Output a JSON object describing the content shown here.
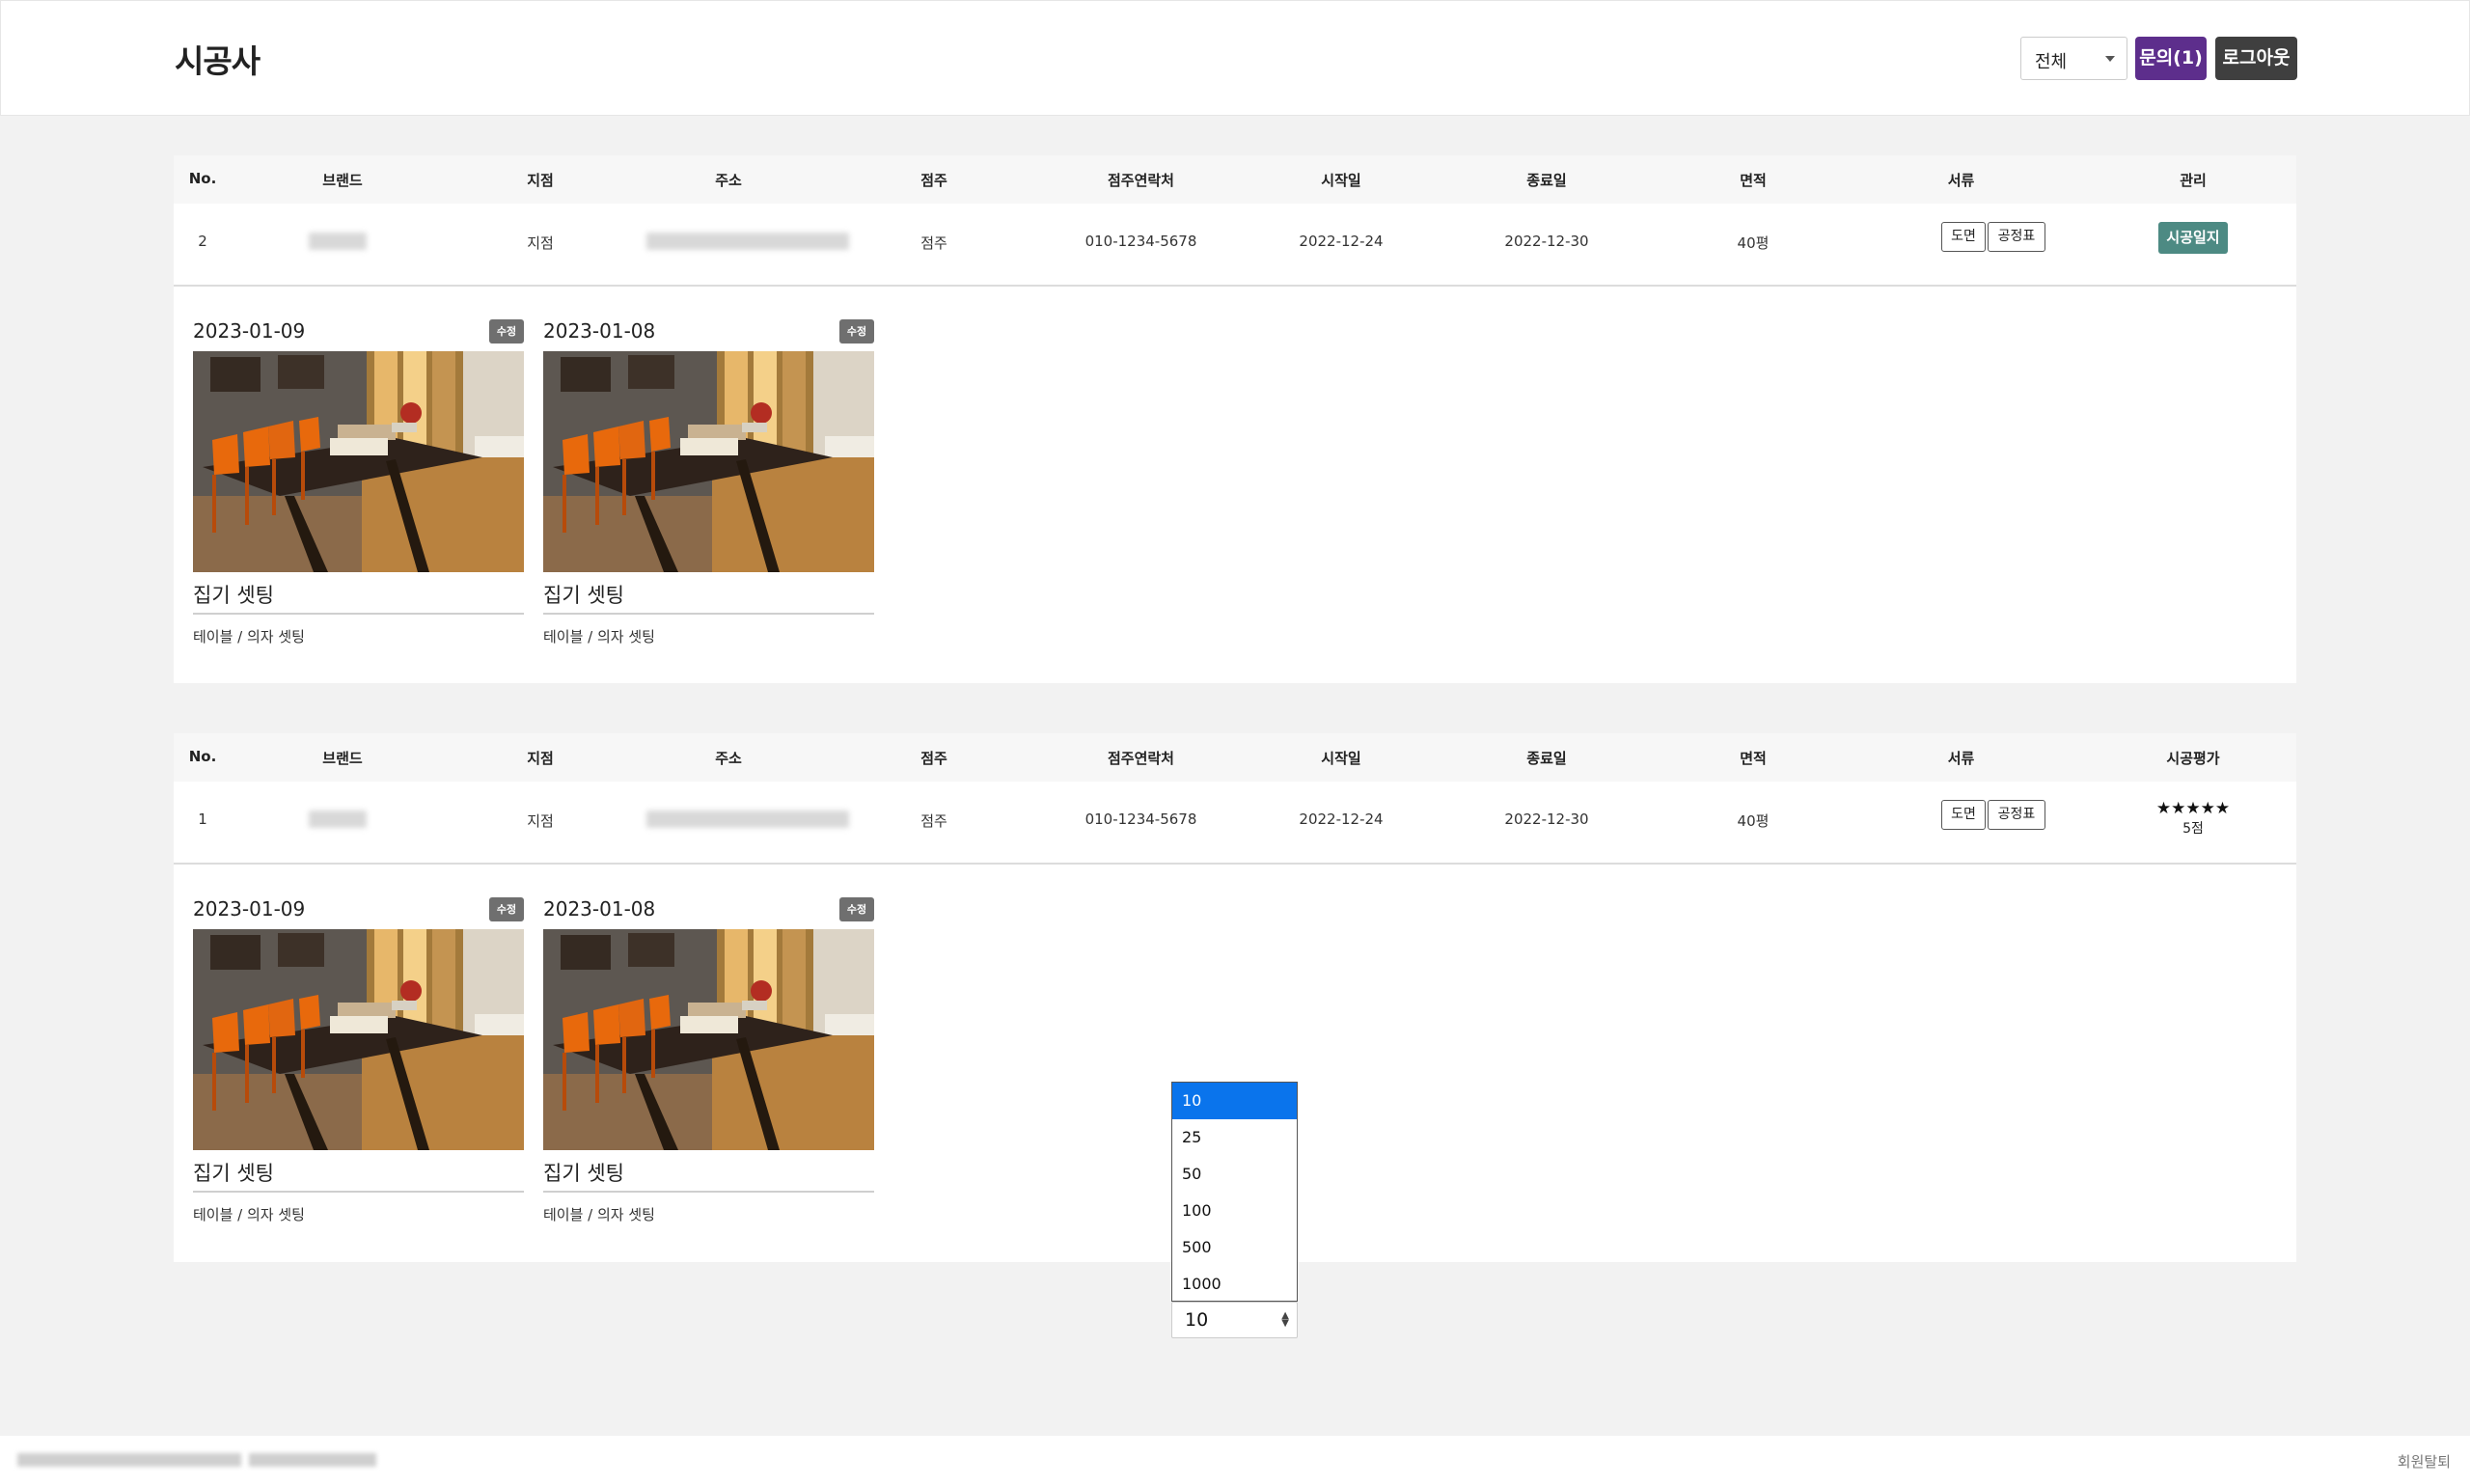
{
  "header": {
    "title": "시공사",
    "filter_value": "전체",
    "inquiry_label": "문의(1)",
    "logout_label": "로그아웃"
  },
  "columns": {
    "no": "No.",
    "brand": "브랜드",
    "branch": "지점",
    "address": "주소",
    "owner": "점주",
    "owner_contact": "점주연락처",
    "start_date": "시작일",
    "end_date": "종료일",
    "area": "면적",
    "documents": "서류",
    "manage": "관리",
    "rating": "시공평가"
  },
  "projects": [
    {
      "no": "2",
      "branch": "지점",
      "owner": "점주",
      "contact": "010-1234-5678",
      "start": "2022-12-24",
      "end": "2022-12-30",
      "area": "40평",
      "doc_buttons": [
        "도면",
        "공정표"
      ],
      "action_label": "시공일지",
      "last_header": "관리",
      "logs": [
        {
          "date": "2023-01-09",
          "badge": "수정",
          "title": "집기 셋팅",
          "desc": "테이블 / 의자 셋팅"
        },
        {
          "date": "2023-01-08",
          "badge": "수정",
          "title": "집기 셋팅",
          "desc": "테이블 / 의자 셋팅"
        }
      ]
    },
    {
      "no": "1",
      "branch": "지점",
      "owner": "점주",
      "contact": "010-1234-5678",
      "start": "2022-12-24",
      "end": "2022-12-30",
      "area": "40평",
      "doc_buttons": [
        "도면",
        "공정표"
      ],
      "rating_stars": "★★★★★",
      "rating_score": "5점",
      "rating_value": 5,
      "rating_max": 5,
      "last_header": "시공평가",
      "logs": [
        {
          "date": "2023-01-09",
          "badge": "수정",
          "title": "집기 셋팅",
          "desc": "테이블 / 의자 셋팅"
        },
        {
          "date": "2023-01-08",
          "badge": "수정",
          "title": "집기 셋팅",
          "desc": "테이블 / 의자 셋팅"
        }
      ]
    }
  ],
  "pagination": {
    "page_size_value": "10",
    "options": [
      "10",
      "25",
      "50",
      "100",
      "500",
      "1000"
    ],
    "selected_option": "10"
  },
  "footer": {
    "withdraw_label": "회원탈퇴"
  },
  "colors": {
    "inquiry_button": "#5d2e8c",
    "logout_button": "#3f3f3f",
    "log_button": "#4d8a83",
    "selected_option": "#0a74ec"
  }
}
